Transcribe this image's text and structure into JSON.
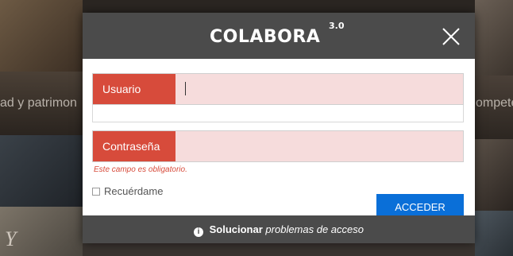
{
  "background": {
    "left_text": "ad y patrimon",
    "right_text": "ompete",
    "left_letter": "Y"
  },
  "modal": {
    "logo_text": "COLABORA",
    "logo_superscript": "3.0",
    "close_icon": "close-icon",
    "username": {
      "label": "Usuario",
      "value": ""
    },
    "password": {
      "label": "Contraseña",
      "value": ""
    },
    "error_text": "Este campo es obligatorio.",
    "remember_label": "Recuérdame",
    "submit_label": "ACCEDER",
    "footer": {
      "bold": "Solucionar",
      "rest": "problemas de acceso",
      "icon": "info-icon"
    }
  },
  "colors": {
    "label_bg": "#d74b3b",
    "field_bg": "#f6dcdc",
    "header_bg": "#4b4b4b",
    "button_bg": "#0a6fd8"
  }
}
